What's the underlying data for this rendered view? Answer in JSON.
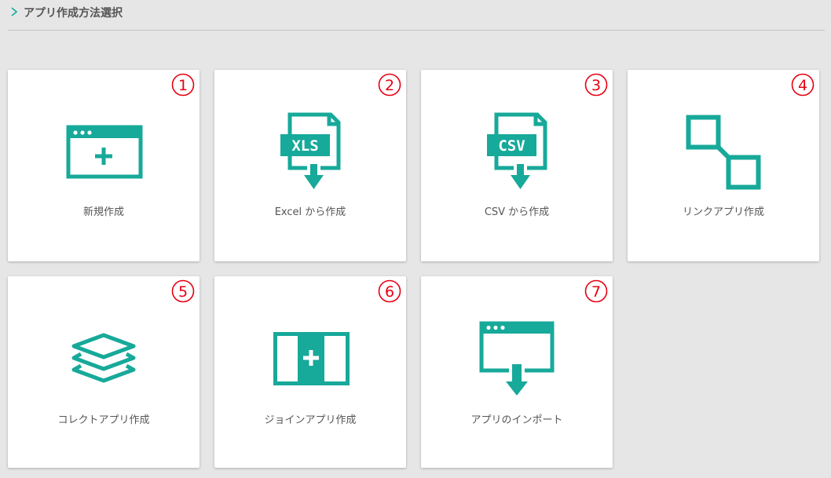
{
  "page": {
    "title": "アプリ作成方法選択"
  },
  "colors": {
    "accent": "#17a99a",
    "number": "#e60012",
    "background": "#e6e6e6",
    "card": "#ffffff",
    "text": "#555555"
  },
  "cards": [
    {
      "number": "1",
      "label": "新規作成",
      "icon": "new-app-window-plus-icon"
    },
    {
      "number": "2",
      "label": "Excel から作成",
      "icon": "xls-file-download-icon",
      "icon_text": "XLS"
    },
    {
      "number": "3",
      "label": "CSV から作成",
      "icon": "csv-file-download-icon",
      "icon_text": "CSV"
    },
    {
      "number": "4",
      "label": "リンクアプリ作成",
      "icon": "link-squares-icon"
    },
    {
      "number": "5",
      "label": "コレクトアプリ作成",
      "icon": "collect-layers-icon"
    },
    {
      "number": "6",
      "label": "ジョインアプリ作成",
      "icon": "join-panels-plus-icon"
    },
    {
      "number": "7",
      "label": "アプリのインポート",
      "icon": "import-window-download-icon"
    }
  ]
}
